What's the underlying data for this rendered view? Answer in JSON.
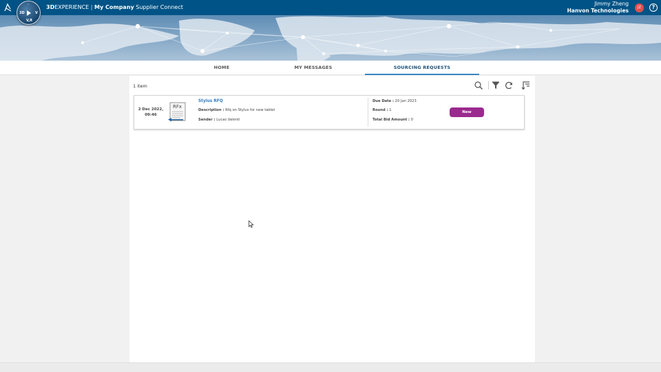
{
  "topbar": {
    "brand_bold": "3D",
    "brand_rest": "EXPERIENCE",
    "separator": "|",
    "tenant": "My Company",
    "app": "Supplier Connect",
    "compass_labels": {
      "top": "·",
      "left": "3D",
      "right": "V",
      "bottom": "V,R"
    },
    "user_name": "Jimmy Zheng",
    "user_company": "Hanvon Technologies",
    "avatar_initials": "JZ",
    "help_symbol": "?"
  },
  "nav": {
    "tabs": [
      {
        "label": "HOME",
        "active": false
      },
      {
        "label": "MY MESSAGES",
        "active": false
      },
      {
        "label": "SOURCING REQUESTS",
        "active": true
      }
    ]
  },
  "toolbar": {
    "count": "1 item",
    "icons": [
      "search-icon",
      "filter-icon",
      "refresh-icon",
      "sort-icon"
    ]
  },
  "requests": [
    {
      "date": "2 Dec 2022,",
      "time": "09:46",
      "doc_label": "RFx",
      "title": "Stylus RFQ",
      "description_label": "Description :",
      "description": "Rfq on Stylus for new tablet",
      "sender_label": "Sender :",
      "sender": "Lucas Valenti",
      "due_label": "Due Date :",
      "due": "20 Jan 2023",
      "round_label": "Round :",
      "round": "1",
      "bid_label": "Total Bid Amount :",
      "bid": "0",
      "status": "New"
    }
  ],
  "colors": {
    "topbar": "#005386",
    "active_tab": "#3a86c1",
    "status_new": "#9b2a8f",
    "title_link": "#2e7bbd"
  }
}
